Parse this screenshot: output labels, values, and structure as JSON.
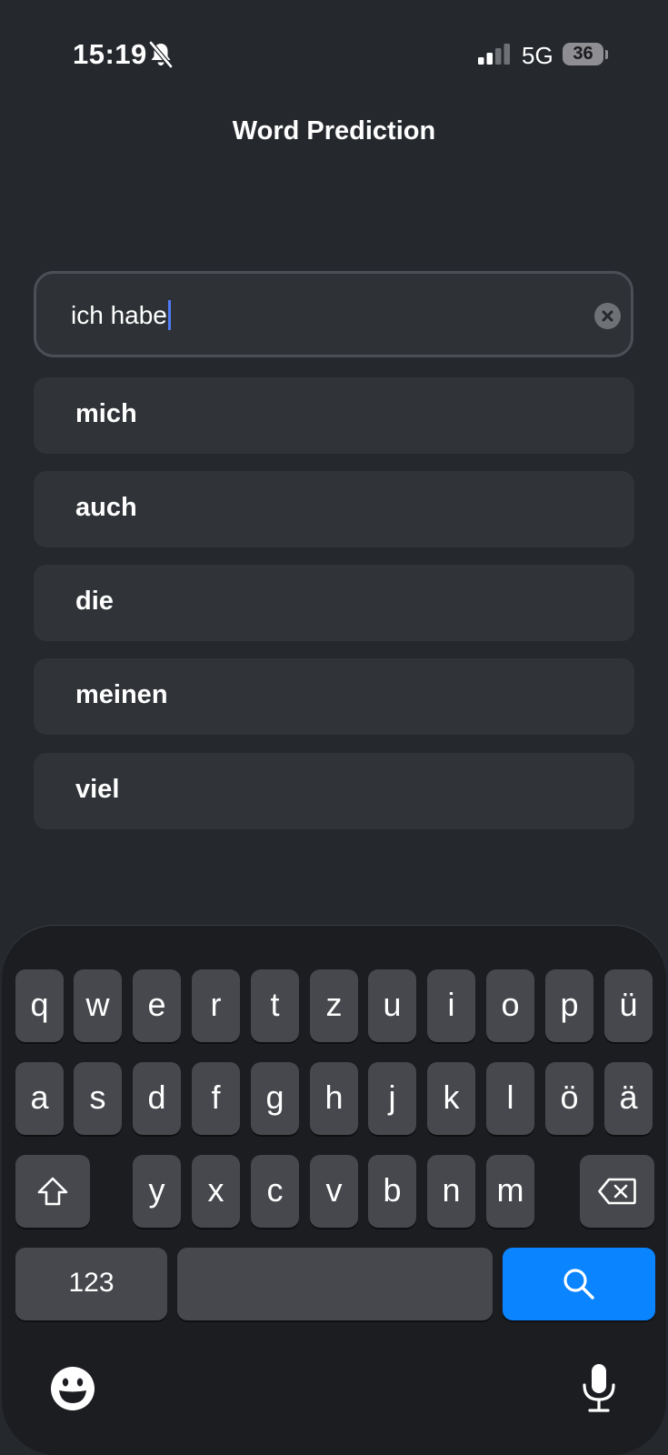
{
  "status_bar": {
    "time": "15:19",
    "network": "5G",
    "battery": "36"
  },
  "page": {
    "title": "Word Prediction"
  },
  "search": {
    "value": "ich habe"
  },
  "suggestions": [
    "mich",
    "auch",
    "die",
    "meinen",
    "viel"
  ],
  "keyboard": {
    "row1": [
      "q",
      "w",
      "e",
      "r",
      "t",
      "z",
      "u",
      "i",
      "o",
      "p",
      "ü"
    ],
    "row2": [
      "a",
      "s",
      "d",
      "f",
      "g",
      "h",
      "j",
      "k",
      "l",
      "ö",
      "ä"
    ],
    "row3": [
      "y",
      "x",
      "c",
      "v",
      "b",
      "n",
      "m"
    ],
    "numbers_label": "123",
    "icons": {
      "shift": "shift-icon",
      "delete": "backspace-icon",
      "search": "search-icon",
      "emoji": "emoji-icon",
      "mic": "microphone-icon"
    }
  },
  "colors": {
    "background": "#25282d",
    "accent": "#0a84ff",
    "caret": "#4e7bf5"
  }
}
